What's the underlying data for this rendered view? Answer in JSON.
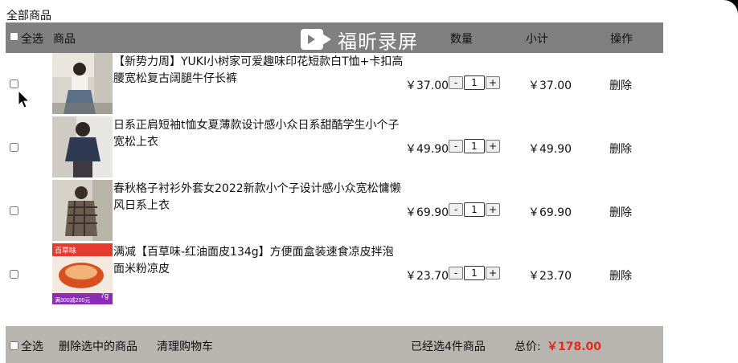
{
  "page_title": "全部商品",
  "header": {
    "select_all": "全选",
    "col_product": "商品",
    "col_qty": "数量",
    "col_subtotal": "小计",
    "col_action": "操作"
  },
  "watermark": "福昕录屏",
  "items": [
    {
      "name": "【新势力周】YUKI小树家可爱趣味印花短款白T恤+卡扣高腰宽松复古阔腿牛仔长裤",
      "price": "￥37.00",
      "qty": "1",
      "subtotal": "￥37.00",
      "delete": "删除",
      "minus": "-",
      "plus": "+"
    },
    {
      "name": "日系正肩短袖t恤女夏薄款设计感小众日系甜酷学生小个子宽松上衣",
      "price": "￥49.90",
      "qty": "1",
      "subtotal": "￥49.90",
      "delete": "删除",
      "minus": "-",
      "plus": "+"
    },
    {
      "name": "春秋格子衬衫外套女2022新款小个子设计感小众宽松慵懒风日系上衣",
      "price": "￥69.90",
      "qty": "1",
      "subtotal": "￥69.90",
      "delete": "删除",
      "minus": "-",
      "plus": "+"
    },
    {
      "name": "满减【百草味-红油面皮134g】方便面盒装速食凉皮拌泡面米粉凉皮",
      "price": "￥23.70",
      "qty": "1",
      "subtotal": "￥23.70",
      "delete": "删除",
      "minus": "-",
      "plus": "+",
      "thumb_text_top": "百草味",
      "thumb_text_bottom": "满300减200元",
      "thumb_text_badge": "7g"
    }
  ],
  "footer": {
    "select_all": "全选",
    "delete_selected": "删除选中的商品",
    "clear_cart": "清理购物车",
    "selected_count": "已经选4件商品",
    "total_label": "总价:",
    "total_value": "￥178.00"
  }
}
